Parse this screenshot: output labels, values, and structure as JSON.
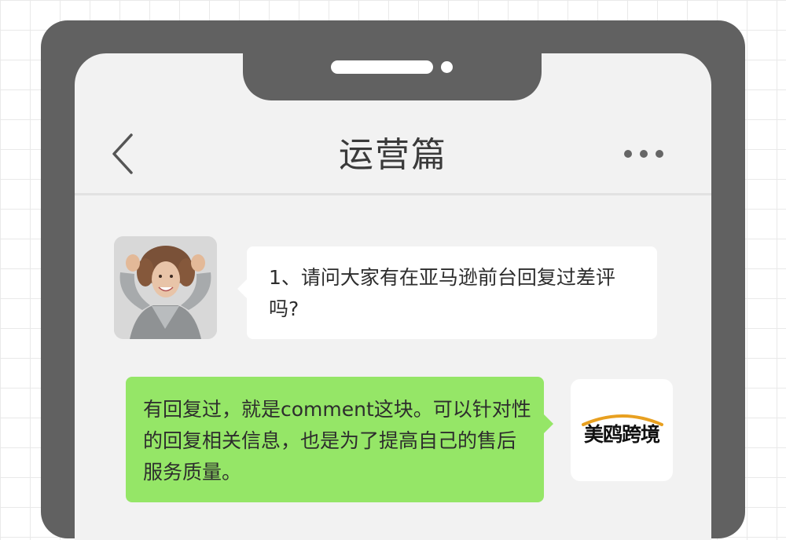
{
  "nav": {
    "title": "运营篇",
    "back_icon": "chevron-left-icon",
    "more_icon": "more-horizontal-icon"
  },
  "messages": [
    {
      "sender": "user",
      "avatar": "user-avatar-photo",
      "text": "1、请问大家有在亚马逊前台回复过差评吗?"
    },
    {
      "sender": "brand",
      "avatar": "brand-logo",
      "text": "有回复过，就是comment这块。可以针对性的回复相关信息，也是为了提高自己的售后服务质量。"
    }
  ],
  "brand": {
    "logo_text": "美鸥跨境",
    "arc_color": "#e8a020"
  },
  "colors": {
    "phone_frame": "#616161",
    "screen_bg": "#f2f2f2",
    "incoming_bubble": "#ffffff",
    "outgoing_bubble": "#95e667"
  }
}
